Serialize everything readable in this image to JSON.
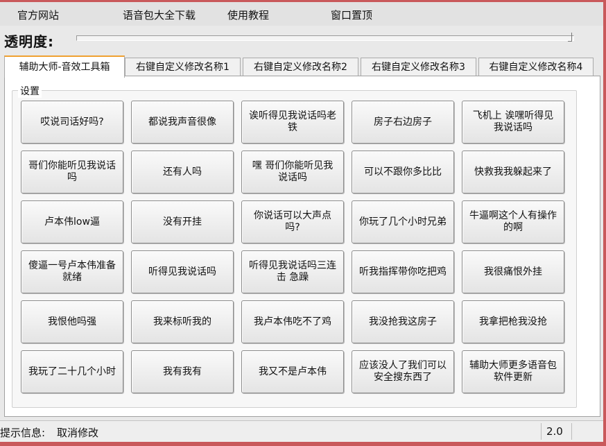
{
  "menu": [
    "官方网站",
    "语音包大全下载",
    "使用教程",
    "窗口置顶"
  ],
  "transparency_label": "透明度:",
  "tabs": [
    "辅助大师-音效工具箱",
    "右键自定义修改名称1",
    "右键自定义修改名称2",
    "右键自定义修改名称3",
    "右键自定义修改名称4"
  ],
  "active_tab": 0,
  "group_title": "设置",
  "buttons": [
    "哎说司话好吗?",
    "都说我声音很像",
    "诶听得见我说话吗老铁",
    "房子右边房子",
    "飞机上 诶嘿听得见我说话吗",
    "哥们你能听见我说话吗",
    "还有人吗",
    "嘿 哥们你能听见我说话吗",
    "可以不跟你多比比",
    "快救我我躲起来了",
    "卢本伟low逼",
    "没有开挂",
    "你说话可以大声点吗?",
    "你玩了几个小时兄弟",
    "牛逼啊这个人有操作的啊",
    "傻逼一号卢本伟准备就绪",
    "听得见我说话吗",
    "听得见我说话吗三连击 急躁",
    "听我指挥带你吃把鸡",
    "我很痛恨外挂",
    "我恨他吗强",
    "我来标听我的",
    "我卢本伟吃不了鸡",
    "我没抢我这房子",
    "我拿把枪我没抢",
    "我玩了二十几个小时",
    "我有我有",
    "我又不是卢本伟",
    "应该没人了我们可以安全搜东西了",
    "辅助大师更多语音包软件更新"
  ],
  "status": {
    "label": "提示信息:",
    "text": "取消修改",
    "version": "2.0"
  },
  "colors": {
    "window_border": "#c9595b",
    "active_tab_accent": "#f0a030"
  }
}
